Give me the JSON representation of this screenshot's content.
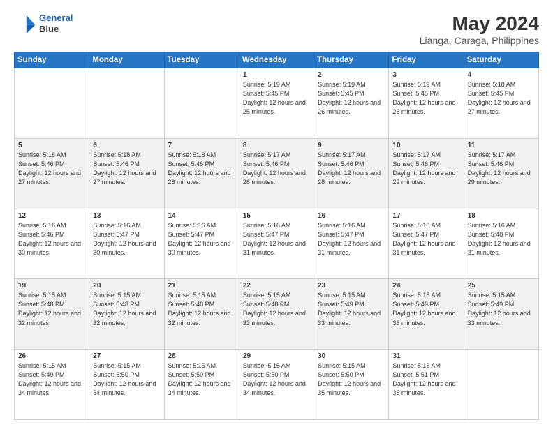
{
  "header": {
    "logo_line1": "General",
    "logo_line2": "Blue",
    "title": "May 2024",
    "subtitle": "Lianga, Caraga, Philippines"
  },
  "weekdays": [
    "Sunday",
    "Monday",
    "Tuesday",
    "Wednesday",
    "Thursday",
    "Friday",
    "Saturday"
  ],
  "weeks": [
    [
      {
        "day": "",
        "sunrise": "",
        "sunset": "",
        "daylight": ""
      },
      {
        "day": "",
        "sunrise": "",
        "sunset": "",
        "daylight": ""
      },
      {
        "day": "",
        "sunrise": "",
        "sunset": "",
        "daylight": ""
      },
      {
        "day": "1",
        "sunrise": "Sunrise: 5:19 AM",
        "sunset": "Sunset: 5:45 PM",
        "daylight": "Daylight: 12 hours and 25 minutes."
      },
      {
        "day": "2",
        "sunrise": "Sunrise: 5:19 AM",
        "sunset": "Sunset: 5:45 PM",
        "daylight": "Daylight: 12 hours and 26 minutes."
      },
      {
        "day": "3",
        "sunrise": "Sunrise: 5:19 AM",
        "sunset": "Sunset: 5:45 PM",
        "daylight": "Daylight: 12 hours and 26 minutes."
      },
      {
        "day": "4",
        "sunrise": "Sunrise: 5:18 AM",
        "sunset": "Sunset: 5:45 PM",
        "daylight": "Daylight: 12 hours and 27 minutes."
      }
    ],
    [
      {
        "day": "5",
        "sunrise": "Sunrise: 5:18 AM",
        "sunset": "Sunset: 5:46 PM",
        "daylight": "Daylight: 12 hours and 27 minutes."
      },
      {
        "day": "6",
        "sunrise": "Sunrise: 5:18 AM",
        "sunset": "Sunset: 5:46 PM",
        "daylight": "Daylight: 12 hours and 27 minutes."
      },
      {
        "day": "7",
        "sunrise": "Sunrise: 5:18 AM",
        "sunset": "Sunset: 5:46 PM",
        "daylight": "Daylight: 12 hours and 28 minutes."
      },
      {
        "day": "8",
        "sunrise": "Sunrise: 5:17 AM",
        "sunset": "Sunset: 5:46 PM",
        "daylight": "Daylight: 12 hours and 28 minutes."
      },
      {
        "day": "9",
        "sunrise": "Sunrise: 5:17 AM",
        "sunset": "Sunset: 5:46 PM",
        "daylight": "Daylight: 12 hours and 28 minutes."
      },
      {
        "day": "10",
        "sunrise": "Sunrise: 5:17 AM",
        "sunset": "Sunset: 5:46 PM",
        "daylight": "Daylight: 12 hours and 29 minutes."
      },
      {
        "day": "11",
        "sunrise": "Sunrise: 5:17 AM",
        "sunset": "Sunset: 5:46 PM",
        "daylight": "Daylight: 12 hours and 29 minutes."
      }
    ],
    [
      {
        "day": "12",
        "sunrise": "Sunrise: 5:16 AM",
        "sunset": "Sunset: 5:46 PM",
        "daylight": "Daylight: 12 hours and 30 minutes."
      },
      {
        "day": "13",
        "sunrise": "Sunrise: 5:16 AM",
        "sunset": "Sunset: 5:47 PM",
        "daylight": "Daylight: 12 hours and 30 minutes."
      },
      {
        "day": "14",
        "sunrise": "Sunrise: 5:16 AM",
        "sunset": "Sunset: 5:47 PM",
        "daylight": "Daylight: 12 hours and 30 minutes."
      },
      {
        "day": "15",
        "sunrise": "Sunrise: 5:16 AM",
        "sunset": "Sunset: 5:47 PM",
        "daylight": "Daylight: 12 hours and 31 minutes."
      },
      {
        "day": "16",
        "sunrise": "Sunrise: 5:16 AM",
        "sunset": "Sunset: 5:47 PM",
        "daylight": "Daylight: 12 hours and 31 minutes."
      },
      {
        "day": "17",
        "sunrise": "Sunrise: 5:16 AM",
        "sunset": "Sunset: 5:47 PM",
        "daylight": "Daylight: 12 hours and 31 minutes."
      },
      {
        "day": "18",
        "sunrise": "Sunrise: 5:16 AM",
        "sunset": "Sunset: 5:48 PM",
        "daylight": "Daylight: 12 hours and 31 minutes."
      }
    ],
    [
      {
        "day": "19",
        "sunrise": "Sunrise: 5:15 AM",
        "sunset": "Sunset: 5:48 PM",
        "daylight": "Daylight: 12 hours and 32 minutes."
      },
      {
        "day": "20",
        "sunrise": "Sunrise: 5:15 AM",
        "sunset": "Sunset: 5:48 PM",
        "daylight": "Daylight: 12 hours and 32 minutes."
      },
      {
        "day": "21",
        "sunrise": "Sunrise: 5:15 AM",
        "sunset": "Sunset: 5:48 PM",
        "daylight": "Daylight: 12 hours and 32 minutes."
      },
      {
        "day": "22",
        "sunrise": "Sunrise: 5:15 AM",
        "sunset": "Sunset: 5:48 PM",
        "daylight": "Daylight: 12 hours and 33 minutes."
      },
      {
        "day": "23",
        "sunrise": "Sunrise: 5:15 AM",
        "sunset": "Sunset: 5:49 PM",
        "daylight": "Daylight: 12 hours and 33 minutes."
      },
      {
        "day": "24",
        "sunrise": "Sunrise: 5:15 AM",
        "sunset": "Sunset: 5:49 PM",
        "daylight": "Daylight: 12 hours and 33 minutes."
      },
      {
        "day": "25",
        "sunrise": "Sunrise: 5:15 AM",
        "sunset": "Sunset: 5:49 PM",
        "daylight": "Daylight: 12 hours and 33 minutes."
      }
    ],
    [
      {
        "day": "26",
        "sunrise": "Sunrise: 5:15 AM",
        "sunset": "Sunset: 5:49 PM",
        "daylight": "Daylight: 12 hours and 34 minutes."
      },
      {
        "day": "27",
        "sunrise": "Sunrise: 5:15 AM",
        "sunset": "Sunset: 5:50 PM",
        "daylight": "Daylight: 12 hours and 34 minutes."
      },
      {
        "day": "28",
        "sunrise": "Sunrise: 5:15 AM",
        "sunset": "Sunset: 5:50 PM",
        "daylight": "Daylight: 12 hours and 34 minutes."
      },
      {
        "day": "29",
        "sunrise": "Sunrise: 5:15 AM",
        "sunset": "Sunset: 5:50 PM",
        "daylight": "Daylight: 12 hours and 34 minutes."
      },
      {
        "day": "30",
        "sunrise": "Sunrise: 5:15 AM",
        "sunset": "Sunset: 5:50 PM",
        "daylight": "Daylight: 12 hours and 35 minutes."
      },
      {
        "day": "31",
        "sunrise": "Sunrise: 5:15 AM",
        "sunset": "Sunset: 5:51 PM",
        "daylight": "Daylight: 12 hours and 35 minutes."
      },
      {
        "day": "",
        "sunrise": "",
        "sunset": "",
        "daylight": ""
      }
    ]
  ]
}
